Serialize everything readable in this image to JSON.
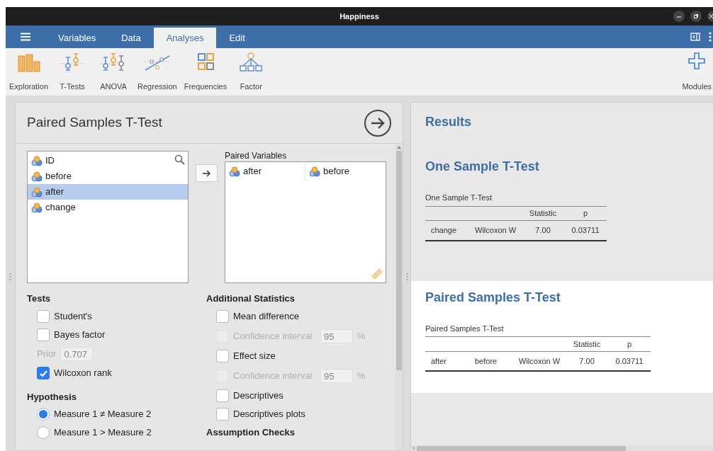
{
  "window": {
    "title": "Happiness"
  },
  "menu_bar": {
    "tabs": [
      {
        "label": "Variables",
        "selected": false
      },
      {
        "label": "Data",
        "selected": false
      },
      {
        "label": "Analyses",
        "selected": true
      },
      {
        "label": "Edit",
        "selected": false
      }
    ]
  },
  "ribbon": {
    "items": [
      {
        "label": "Exploration",
        "kind": "bars"
      },
      {
        "label": "T-Tests",
        "kind": "ttest"
      },
      {
        "label": "ANOVA",
        "kind": "anova"
      },
      {
        "label": "Regression",
        "kind": "regression"
      },
      {
        "label": "Frequencies",
        "kind": "frequencies"
      },
      {
        "label": "Factor",
        "kind": "factor"
      }
    ],
    "modules": "Modules"
  },
  "analysis": {
    "title": "Paired Samples T-Test",
    "variables": [
      {
        "name": "ID",
        "selected": false
      },
      {
        "name": "before",
        "selected": false
      },
      {
        "name": "after",
        "selected": true
      },
      {
        "name": "change",
        "selected": false
      }
    ],
    "paired_variables": {
      "label": "Paired Variables",
      "pairs": [
        [
          "after",
          "before"
        ]
      ]
    },
    "tests": {
      "heading": "Tests",
      "items": [
        {
          "kind": "checkbox",
          "label": "Student's",
          "checked": false,
          "children": [
            {
              "kind": "checkbox",
              "label": "Bayes factor",
              "checked": false,
              "children": [
                {
                  "kind": "field",
                  "label": "Prior",
                  "value": "0.707",
                  "disabled": true
                }
              ]
            }
          ]
        },
        {
          "kind": "checkbox",
          "label": "Wilcoxon rank",
          "checked": true
        }
      ]
    },
    "hypothesis": {
      "heading": "Hypothesis",
      "options": [
        {
          "label": "Measure 1 ≠ Measure 2",
          "selected": true
        },
        {
          "label": "Measure 1 > Measure 2",
          "selected": false
        }
      ]
    },
    "additional_statistics": {
      "heading": "Additional Statistics",
      "items": [
        {
          "kind": "checkbox",
          "label": "Mean difference",
          "checked": false,
          "children": [
            {
              "kind": "interval",
              "label": "Confidence interval",
              "checked": false,
              "disabled": true,
              "value": "95",
              "unit": "%"
            }
          ]
        },
        {
          "kind": "checkbox",
          "label": "Effect size",
          "checked": false,
          "children": [
            {
              "kind": "interval",
              "label": "Confidence interval",
              "checked": false,
              "disabled": true,
              "value": "95",
              "unit": "%"
            }
          ]
        },
        {
          "kind": "checkbox",
          "label": "Descriptives",
          "checked": false
        },
        {
          "kind": "checkbox",
          "label": "Descriptives plots",
          "checked": false
        }
      ]
    },
    "assumption_checks": {
      "heading": "Assumption Checks"
    }
  },
  "results": {
    "title": "Results",
    "sections": [
      {
        "title": "One Sample T-Test",
        "selected": false,
        "table": {
          "caption": "One Sample T-Test",
          "header": [
            "Statistic",
            "p"
          ],
          "rows": [
            [
              "change",
              "Wilcoxon W",
              "7.00",
              "0.03711"
            ]
          ]
        }
      },
      {
        "title": "Paired Samples T-Test",
        "selected": true,
        "table": {
          "caption": "Paired Samples T-Test",
          "header": [
            "Statistic",
            "p"
          ],
          "rows": [
            [
              "after",
              "before",
              "Wilcoxon W",
              "7.00",
              "0.03711"
            ]
          ]
        }
      }
    ]
  }
}
